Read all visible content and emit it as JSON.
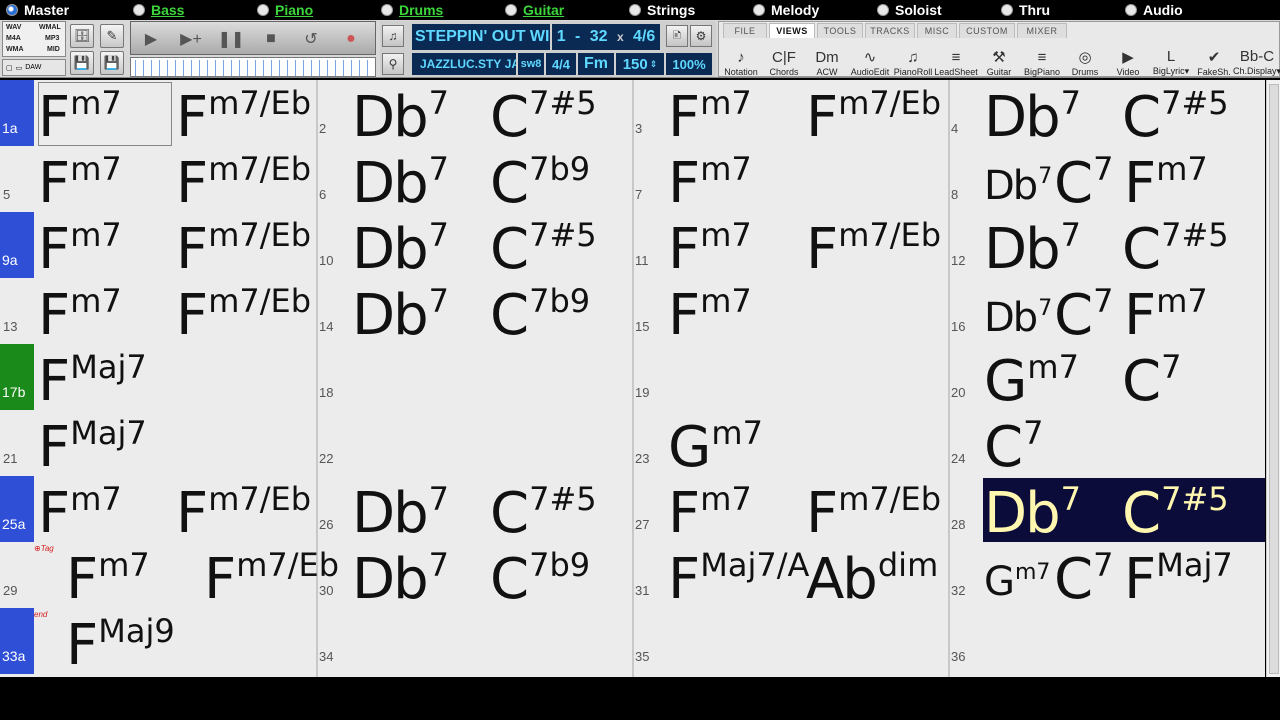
{
  "tracks": [
    {
      "label": "Master",
      "active": true
    },
    {
      "label": "Bass",
      "green": true
    },
    {
      "label": "Piano",
      "green": true
    },
    {
      "label": "Drums",
      "green": true
    },
    {
      "label": "Guitar",
      "green": true
    },
    {
      "label": "Strings"
    },
    {
      "label": "Melody"
    },
    {
      "label": "Soloist"
    },
    {
      "label": "Thru"
    },
    {
      "label": "Audio"
    }
  ],
  "formats": {
    "wav": "WAV",
    "wma": "WMAL",
    "m4a": "M4A",
    "mp3": "MP3",
    "wma2": "WMA",
    "mid": "MID",
    "daw": "DAW"
  },
  "song": {
    "title": "STEPPIN' OUT WI",
    "loop_start": "1",
    "loop_end": "32",
    "repeats": "4/6",
    "style": "JAZZLUC.STY",
    "style_suffix": "JAZ",
    "style_code": "sw8",
    "time_sig": "4/4",
    "key": "Fm",
    "tempo": "150",
    "volume": "100%"
  },
  "ribbon": {
    "tabs": [
      "FILE",
      "VIEWS",
      "TOOLS",
      "TRACKS",
      "MISC",
      "CUSTOM",
      "MIXER"
    ],
    "selected_tab": "VIEWS",
    "buttons": [
      "Notation",
      "Chords",
      "ACW",
      "AudioEdit",
      "PianoRoll",
      "LeadSheet",
      "Guitar",
      "BigPiano",
      "Drums",
      "Video",
      "BigLyric▾",
      "FakeSh.",
      "Ch.Display▾"
    ]
  },
  "sheet": {
    "rows": [
      {
        "bars": [
          {
            "num": "1a",
            "part": "blue",
            "chords": [
              [
                "F",
                "m7"
              ],
              [
                "F",
                "m7/Eb"
              ]
            ]
          },
          {
            "num": "2",
            "chords": [
              [
                "Db",
                "7"
              ],
              [
                "C",
                "7#5"
              ]
            ]
          },
          {
            "num": "3",
            "chords": [
              [
                "F",
                "m7"
              ],
              [
                "F",
                "m7/Eb"
              ]
            ]
          },
          {
            "num": "4",
            "chords": [
              [
                "Db",
                "7"
              ],
              [
                "C",
                "7#5"
              ]
            ]
          }
        ]
      },
      {
        "bars": [
          {
            "num": "5",
            "chords": [
              [
                "F",
                "m7"
              ],
              [
                "F",
                "m7/Eb"
              ]
            ]
          },
          {
            "num": "6",
            "chords": [
              [
                "Db",
                "7"
              ],
              [
                "C",
                "7b9"
              ]
            ]
          },
          {
            "num": "7",
            "chords": [
              [
                "F",
                "m7"
              ]
            ]
          },
          {
            "num": "8",
            "chords": [
              [
                "Db",
                "7"
              ],
              [
                "C",
                "7"
              ],
              [
                "F",
                "m7"
              ]
            ]
          }
        ]
      },
      {
        "bars": [
          {
            "num": "9a",
            "part": "blue",
            "chords": [
              [
                "F",
                "m7"
              ],
              [
                "F",
                "m7/Eb"
              ]
            ]
          },
          {
            "num": "10",
            "chords": [
              [
                "Db",
                "7"
              ],
              [
                "C",
                "7#5"
              ]
            ]
          },
          {
            "num": "11",
            "chords": [
              [
                "F",
                "m7"
              ],
              [
                "F",
                "m7/Eb"
              ]
            ]
          },
          {
            "num": "12",
            "chords": [
              [
                "Db",
                "7"
              ],
              [
                "C",
                "7#5"
              ]
            ]
          }
        ]
      },
      {
        "bars": [
          {
            "num": "13",
            "chords": [
              [
                "F",
                "m7"
              ],
              [
                "F",
                "m7/Eb"
              ]
            ]
          },
          {
            "num": "14",
            "chords": [
              [
                "Db",
                "7"
              ],
              [
                "C",
                "7b9"
              ]
            ]
          },
          {
            "num": "15",
            "chords": [
              [
                "F",
                "m7"
              ]
            ]
          },
          {
            "num": "16",
            "chords": [
              [
                "Db",
                "7"
              ],
              [
                "C",
                "7"
              ],
              [
                "F",
                "m7"
              ]
            ]
          }
        ]
      },
      {
        "bars": [
          {
            "num": "17b",
            "part": "green",
            "chords": [
              [
                "F",
                "Maj7"
              ]
            ]
          },
          {
            "num": "18",
            "chords": []
          },
          {
            "num": "19",
            "chords": []
          },
          {
            "num": "20",
            "chords": [
              [
                "G",
                "m7"
              ],
              [
                "C",
                "7"
              ]
            ]
          }
        ]
      },
      {
        "bars": [
          {
            "num": "21",
            "chords": [
              [
                "F",
                "Maj7"
              ]
            ]
          },
          {
            "num": "22",
            "chords": []
          },
          {
            "num": "23",
            "chords": [
              [
                "G",
                "m7"
              ]
            ]
          },
          {
            "num": "24",
            "chords": [
              [
                "C",
                "7"
              ]
            ]
          }
        ]
      },
      {
        "bars": [
          {
            "num": "25a",
            "part": "blue",
            "chords": [
              [
                "F",
                "m7"
              ],
              [
                "F",
                "m7/Eb"
              ]
            ]
          },
          {
            "num": "26",
            "chords": [
              [
                "Db",
                "7"
              ],
              [
                "C",
                "7#5"
              ]
            ]
          },
          {
            "num": "27",
            "chords": [
              [
                "F",
                "m7"
              ],
              [
                "F",
                "m7/Eb"
              ]
            ]
          },
          {
            "num": "28",
            "chords": [
              [
                "Db",
                "7"
              ],
              [
                "C",
                "7#5"
              ]
            ],
            "highlight": true
          }
        ]
      },
      {
        "bars": [
          {
            "num": "29",
            "chords": [
              [
                "F",
                "m7"
              ],
              [
                "F",
                "m7/Eb"
              ]
            ],
            "tag": "⊕Tag"
          },
          {
            "num": "30",
            "chords": [
              [
                "Db",
                "7"
              ],
              [
                "C",
                "7b9"
              ]
            ]
          },
          {
            "num": "31",
            "chords": [
              [
                "F",
                "Maj7/A"
              ],
              [
                "Ab",
                "dim"
              ]
            ]
          },
          {
            "num": "32",
            "chords": [
              [
                "G",
                "m7"
              ],
              [
                "C",
                "7"
              ],
              [
                "F",
                "Maj7"
              ]
            ]
          }
        ]
      },
      {
        "bars": [
          {
            "num": "33a",
            "part": "blue",
            "chords": [
              [
                "F",
                "Maj9"
              ]
            ],
            "tag": "end"
          },
          {
            "num": "34",
            "chords": []
          },
          {
            "num": "35",
            "chords": []
          },
          {
            "num": "36",
            "chords": []
          }
        ]
      }
    ]
  }
}
